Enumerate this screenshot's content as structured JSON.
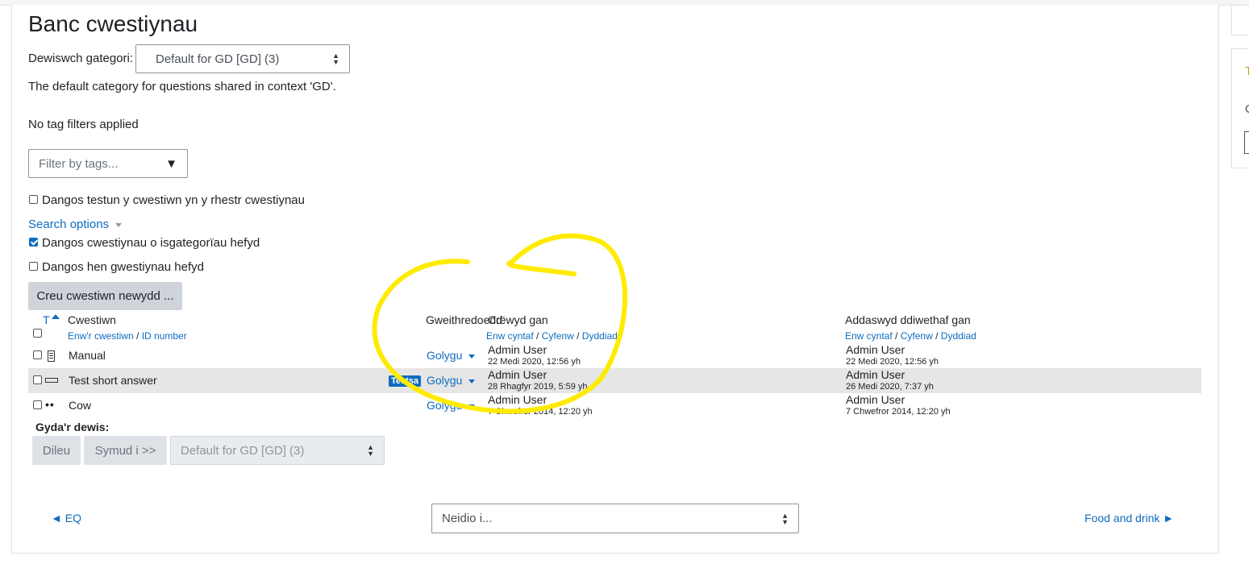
{
  "page_title": "Banc cwestiynau",
  "category": {
    "label": "Dewiswch gategori:",
    "selected": "Default for GD [GD] (3)",
    "description": "The default category for questions shared in context 'GD'."
  },
  "tags": {
    "status": "No tag filters applied",
    "placeholder": "Filter by tags..."
  },
  "options": {
    "show_text_label": "Dangos testun y cwestiwn yn y rhestr cwestiynau",
    "search_options_label": "Search options",
    "subcategories_label": "Dangos cwestiynau o isgategorïau hefyd",
    "old_questions_label": "Dangos hen gwestiynau hefyd"
  },
  "create_button": "Creu cwestiwn newydd ...",
  "table": {
    "col_type": "T",
    "col_question": "Cwestiwn",
    "col_question_sort1": "Enw'r cwestiwn",
    "col_question_sort2": "ID number",
    "col_actions": "Gweithredoedd",
    "col_created": "Crëwyd gan",
    "col_modified": "Addaswyd ddiwethaf gan",
    "sort_first": "Enw cyntaf",
    "sort_last": "Cyfenw",
    "sort_date": "Dyddiad",
    "sep": "/",
    "rows": [
      {
        "name": "Manual",
        "icon": "document-icon",
        "badge": "",
        "action": "Golygu",
        "created_by": "Admin User",
        "created_date": "22 Medi 2020, 12:56 yh",
        "modified_by": "Admin User",
        "modified_date": "22 Medi 2020, 12:56 yh"
      },
      {
        "name": "Test short answer",
        "icon": "short-answer-icon",
        "badge": "Testsa",
        "action": "Golygu",
        "created_by": "Admin User",
        "created_date": "28 Rhagfyr 2019, 5:59 yh",
        "modified_by": "Admin User",
        "modified_date": "26 Medi 2020, 7:37 yh"
      },
      {
        "name": "Cow",
        "icon": "multichoice-dots-icon",
        "badge": "",
        "action": "Golygu",
        "created_by": "Admin User",
        "created_date": "7 Chwefror 2014, 12:20 yh",
        "modified_by": "Admin User",
        "modified_date": "7 Chwefror 2014, 12:20 yh"
      }
    ]
  },
  "bulk": {
    "heading": "Gyda'r dewis:",
    "delete": "Dileu",
    "move": "Symud i >>",
    "target": "Default for GD [GD] (3)"
  },
  "nav": {
    "prev": "◄ EQ",
    "jump": "Neidio i...",
    "next": "Food and drink ►"
  },
  "side": {
    "t": "T",
    "g": "C"
  },
  "colors": {
    "link": "#0f6cbf",
    "highlight_row": "#e6e6e6",
    "annotation": "#ffeb00"
  }
}
